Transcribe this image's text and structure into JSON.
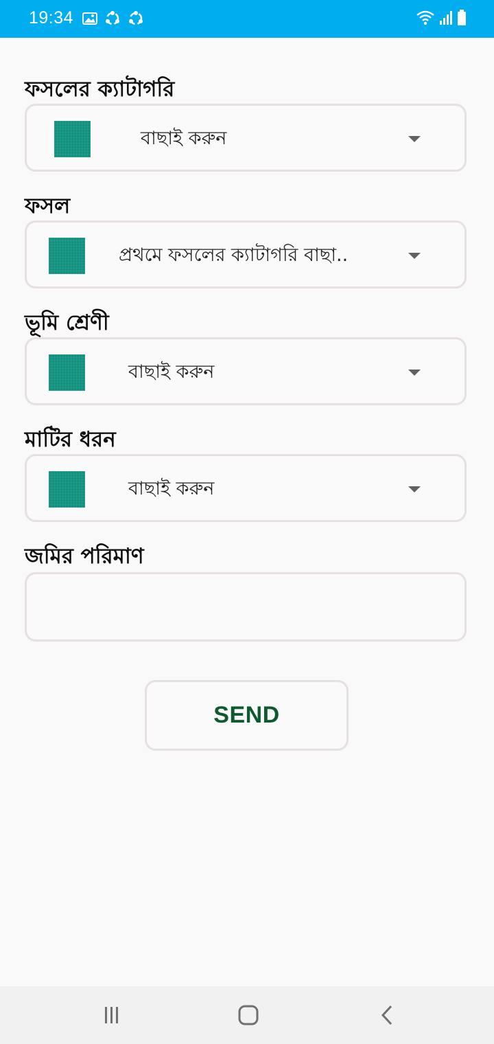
{
  "status_bar": {
    "time": "19:34",
    "background": "#00aeef",
    "left_icons": [
      "gallery-icon",
      "sync-icon",
      "sync-icon"
    ],
    "right_icons": [
      "wifi-icon",
      "signal-icon",
      "battery-icon"
    ]
  },
  "form": {
    "crop_category": {
      "label": "ফসলের ক্যাটাগরি",
      "value": "বাছাই করুন"
    },
    "crop": {
      "label": "ফসল",
      "value": "প্রথমে ফসলের ক্যাটাগরি বাছা.."
    },
    "land_class": {
      "label": "ভূমি শ্রেণী",
      "value": "বাছাই করুন"
    },
    "soil_type": {
      "label": "মাটির ধরন",
      "value": "বাছাই করুন"
    },
    "land_amount": {
      "label": "জমির পরিমাণ",
      "value": ""
    },
    "send_label": "SEND",
    "icon_color": "#11917f",
    "accent_text_color": "#0d5a30"
  },
  "nav_bar": {
    "buttons": [
      "recent-apps-icon",
      "home-icon",
      "back-icon"
    ]
  }
}
